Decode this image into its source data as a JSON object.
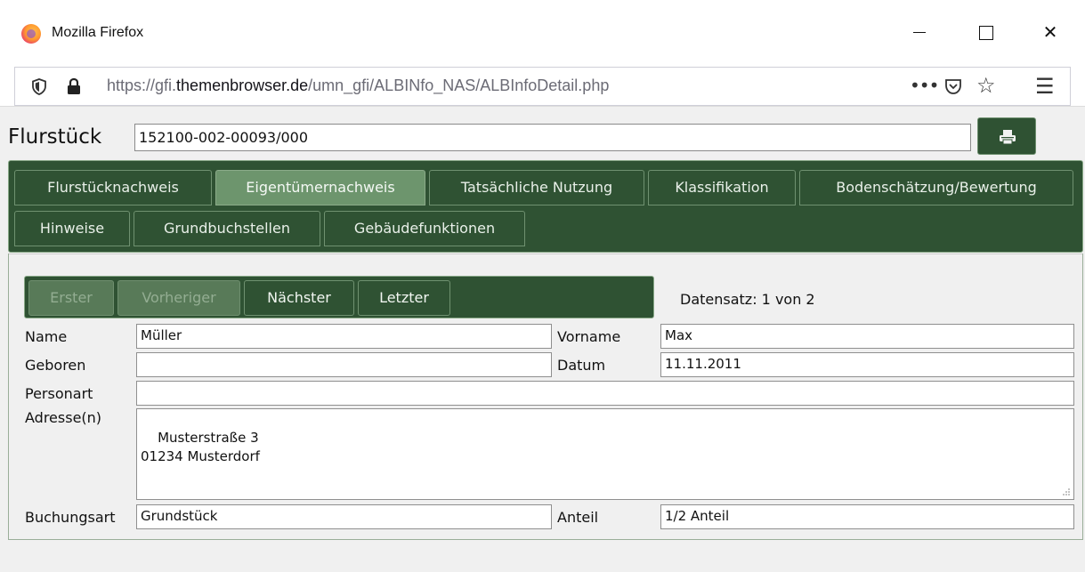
{
  "window": {
    "title": "Mozilla Firefox",
    "close_glyph": "✕"
  },
  "urlbar": {
    "url_prefix": "https://gfi.",
    "url_domain": "themenbrowser.de",
    "url_path": "/umn_gfi/ALBINfo_NAS/ALBInfoDetail.php",
    "more_glyph": "•••",
    "star_glyph": "☆",
    "menu_glyph": "☰"
  },
  "header": {
    "label": "Flurstück",
    "value": "152100-002-00093/000"
  },
  "tabs": [
    {
      "label": "Flurstücknachweis",
      "active": false
    },
    {
      "label": "Eigentümernachweis",
      "active": true
    },
    {
      "label": "Tatsächliche Nutzung",
      "active": false
    },
    {
      "label": "Klassifikation",
      "active": false
    },
    {
      "label": "Bodenschätzung/Bewertung",
      "active": false
    },
    {
      "label": "Hinweise",
      "active": false
    },
    {
      "label": "Grundbuchstellen",
      "active": false
    },
    {
      "label": "Gebäudefunktionen",
      "active": false
    }
  ],
  "record_nav": {
    "first": "Erster",
    "previous": "Vorheriger",
    "next": "Nächster",
    "last": "Letzter",
    "counter": "Datensatz: 1 von 2"
  },
  "form": {
    "name_label": "Name",
    "name_value": "Müller",
    "vorname_label": "Vorname",
    "vorname_value": "Max",
    "geboren_label": "Geboren",
    "geboren_value": "",
    "datum_label": "Datum",
    "datum_value": "11.11.2011",
    "personart_label": "Personart",
    "personart_value": "",
    "adresse_label": "Adresse(n)",
    "adresse_value": "Musterstraße 3\n01234 Musterdorf",
    "buchungsart_label": "Buchungsart",
    "buchungsart_value": "Grundstück",
    "anteil_label": "Anteil",
    "anteil_value": "1/2 Anteil"
  },
  "colors": {
    "panel_green": "#2f5233",
    "active_tab": "#6d956d",
    "page_bg": "#f0f0f0"
  }
}
